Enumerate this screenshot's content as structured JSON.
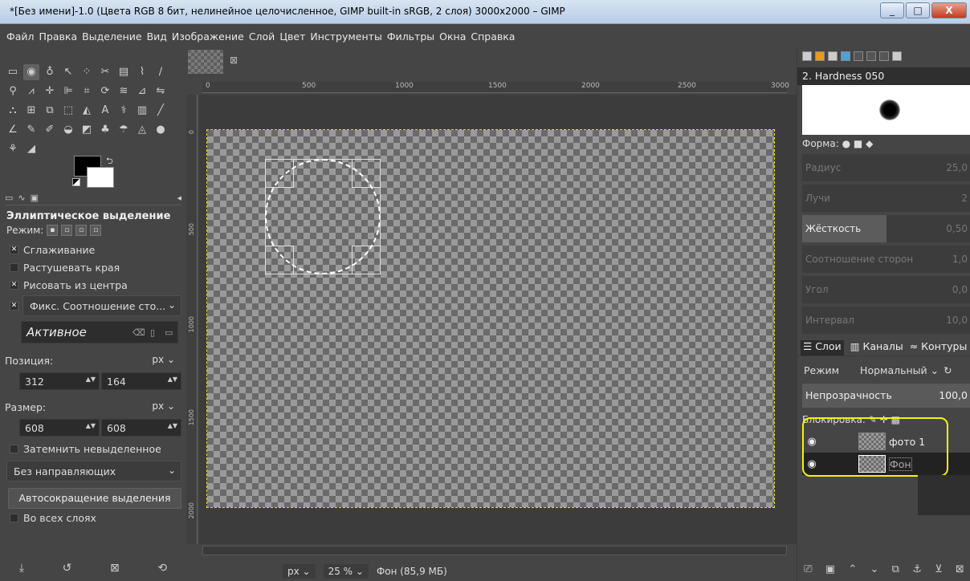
{
  "window": {
    "title": "*[Без имени]-1.0 (Цвета RGB 8 бит, нелинейное целочисленное, GIMP built-in sRGB, 2 слоя) 3000x2000 – GIMP",
    "minimize": "_",
    "maximize": "□",
    "close": "X"
  },
  "menu": [
    "Файл",
    "Правка",
    "Выделение",
    "Вид",
    "Изображение",
    "Слой",
    "Цвет",
    "Инструменты",
    "Фильтры",
    "Окна",
    "Справка"
  ],
  "tool_options": {
    "title": "Эллиптическое выделение",
    "mode_label": "Режим:",
    "antialias": "Сглаживание",
    "feather": "Растушевать края",
    "expand_center": "Рисовать из центра",
    "fixed_combo": "Фикс. Соотношение сто...",
    "fixed_entry": "Активное",
    "position_label": "Позиция:",
    "position_unit": "px",
    "position_x": "312",
    "position_y": "164",
    "size_label": "Размер:",
    "size_unit": "px",
    "size_w": "608",
    "size_h": "608",
    "highlight": "Затемнить невыделенное",
    "guides": "Без направляющих",
    "autoshrink": "Автосокращение выделения",
    "all_layers": "Во всех слоях"
  },
  "ruler": {
    "h_ticks": [
      "0",
      "500",
      "1000",
      "1500",
      "2000",
      "2500",
      "3000"
    ],
    "v_ticks": [
      "0",
      "500",
      "1000",
      "1500",
      "2000"
    ]
  },
  "status": {
    "unit": "px",
    "zoom": "25 %",
    "layer_info": "Фон (85,9 МБ)"
  },
  "brushes": {
    "name": "2. Hardness 050",
    "shape_label": "Форма:",
    "sliders": [
      {
        "label": "Радиус",
        "value": "25,0",
        "active": false
      },
      {
        "label": "Лучи",
        "value": "2",
        "active": false
      },
      {
        "label": "Жёсткость",
        "value": "0,50",
        "active": true,
        "fill": 0.5
      },
      {
        "label": "Соотношение сторон",
        "value": "1,0",
        "active": false
      },
      {
        "label": "Угол",
        "value": "0,0",
        "active": false
      },
      {
        "label": "Интервал",
        "value": "10,0",
        "active": false
      }
    ]
  },
  "layers": {
    "tabs": [
      "Слои",
      "Каналы",
      "Контуры"
    ],
    "mode_label": "Режим",
    "mode_value": "Нормальный",
    "opacity_label": "Непрозрачность",
    "opacity_value": "100,0",
    "lock_label": "Блокировка:",
    "items": [
      {
        "name": "фото 1",
        "selected": false
      },
      {
        "name": "Фон",
        "selected": true
      }
    ]
  },
  "colors": {
    "highlight": "#f5f10e",
    "selection_outline": "#e6e600"
  }
}
